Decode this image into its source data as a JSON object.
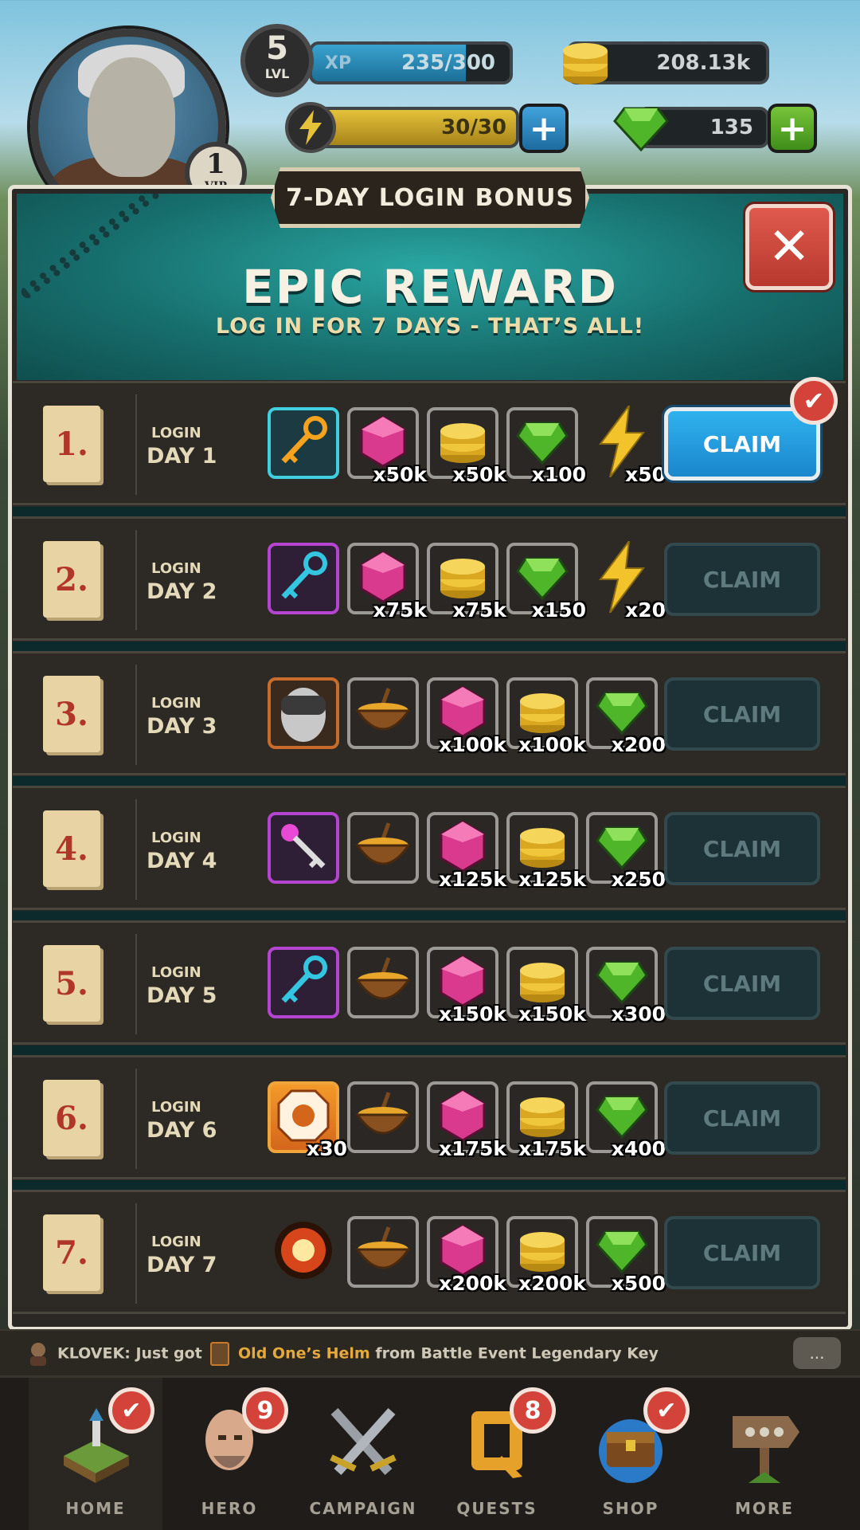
{
  "hud": {
    "level": "5",
    "level_label": "LVL",
    "vip_level": "1",
    "vip_label": "VIP",
    "xp_label": "XP",
    "xp_value": "235/300",
    "xp_fraction": 0.78,
    "gold": "208.13k",
    "energy": "30/30",
    "energy_fraction": 1.0,
    "gems": "135",
    "plus": "+"
  },
  "modal": {
    "tab_title": "7-DAY LOGIN BONUS",
    "title": "EPIC REWARD",
    "subtitle": "LOG IN FOR 7 DAYS - THAT’S ALL!",
    "close_glyph": "✕"
  },
  "days": [
    {
      "num": "1.",
      "login": "LOGIN",
      "day": "DAY 1",
      "claim": "CLAIM",
      "active": true,
      "rewards": [
        {
          "icon": "teal-key-icon",
          "qty": ""
        },
        {
          "icon": "pink-gem-icon",
          "qty": "x50k"
        },
        {
          "icon": "gold-coins-icon",
          "qty": "x50k"
        },
        {
          "icon": "green-gem-icon",
          "qty": "x100"
        },
        {
          "icon": "lightning-icon",
          "qty": "x50"
        }
      ]
    },
    {
      "num": "2.",
      "login": "LOGIN",
      "day": "DAY 2",
      "claim": "CLAIM",
      "active": false,
      "rewards": [
        {
          "icon": "purple-key-icon",
          "qty": ""
        },
        {
          "icon": "pink-gem-icon",
          "qty": "x75k"
        },
        {
          "icon": "gold-coins-icon",
          "qty": "x75k"
        },
        {
          "icon": "green-gem-icon",
          "qty": "x150"
        },
        {
          "icon": "lightning-icon",
          "qty": "x20"
        }
      ]
    },
    {
      "num": "3.",
      "login": "LOGIN",
      "day": "DAY 3",
      "claim": "CLAIM",
      "active": false,
      "rewards": [
        {
          "icon": "hero-helm-icon",
          "qty": ""
        },
        {
          "icon": "soup-bowl-icon",
          "qty": ""
        },
        {
          "icon": "pink-gem-icon",
          "qty": "x100k"
        },
        {
          "icon": "gold-coins-icon",
          "qty": "x100k"
        },
        {
          "icon": "green-gem-icon",
          "qty": "x200"
        }
      ]
    },
    {
      "num": "4.",
      "login": "LOGIN",
      "day": "DAY 4",
      "claim": "CLAIM",
      "active": false,
      "rewards": [
        {
          "icon": "magic-key-icon",
          "qty": ""
        },
        {
          "icon": "soup-bowl-icon",
          "qty": ""
        },
        {
          "icon": "pink-gem-icon",
          "qty": "x125k"
        },
        {
          "icon": "gold-coins-icon",
          "qty": "x125k"
        },
        {
          "icon": "green-gem-icon",
          "qty": "x250"
        }
      ]
    },
    {
      "num": "5.",
      "login": "LOGIN",
      "day": "DAY 5",
      "claim": "CLAIM",
      "active": false,
      "rewards": [
        {
          "icon": "purple-key-icon",
          "qty": ""
        },
        {
          "icon": "soup-bowl-icon",
          "qty": ""
        },
        {
          "icon": "pink-gem-icon",
          "qty": "x150k"
        },
        {
          "icon": "gold-coins-icon",
          "qty": "x150k"
        },
        {
          "icon": "green-gem-icon",
          "qty": "x300"
        }
      ]
    },
    {
      "num": "6.",
      "login": "LOGIN",
      "day": "DAY 6",
      "claim": "CLAIM",
      "active": false,
      "rewards": [
        {
          "icon": "orange-token-icon",
          "qty": "x30"
        },
        {
          "icon": "soup-bowl-icon",
          "qty": ""
        },
        {
          "icon": "pink-gem-icon",
          "qty": "x175k"
        },
        {
          "icon": "gold-coins-icon",
          "qty": "x175k"
        },
        {
          "icon": "green-gem-icon",
          "qty": "x400"
        }
      ]
    },
    {
      "num": "7.",
      "login": "LOGIN",
      "day": "DAY 7",
      "claim": "CLAIM",
      "active": false,
      "rewards": [
        {
          "icon": "fire-orb-icon",
          "qty": ""
        },
        {
          "icon": "soup-bowl-icon",
          "qty": ""
        },
        {
          "icon": "pink-gem-icon",
          "qty": "x200k"
        },
        {
          "icon": "gold-coins-icon",
          "qty": "x200k"
        },
        {
          "icon": "green-gem-icon",
          "qty": "x500"
        }
      ]
    }
  ],
  "chat": {
    "user": "KLOVEK:",
    "text1": "Just got",
    "item": "Old One’s Helm",
    "text2": "from Battle Event Legendary Key",
    "bubble": "..."
  },
  "nav": [
    {
      "label": "HOME",
      "badge": "✔",
      "icon": "home-island-icon",
      "active": true
    },
    {
      "label": "HERO",
      "badge": "9",
      "icon": "hero-head-icon",
      "active": false
    },
    {
      "label": "CAMPAIGN",
      "badge": "",
      "icon": "crossed-swords-icon",
      "active": false
    },
    {
      "label": "QUESTS",
      "badge": "8",
      "icon": "quest-q-icon",
      "active": false
    },
    {
      "label": "SHOP",
      "badge": "✔",
      "icon": "treasure-chest-icon",
      "active": false
    },
    {
      "label": "MORE",
      "badge": "",
      "icon": "signpost-icon",
      "active": false
    }
  ],
  "colors": {
    "claim_active": "#1b86cc",
    "claim_inactive": "#1c3236",
    "badge_red": "#d3433a",
    "teal_header": "#17706e"
  }
}
